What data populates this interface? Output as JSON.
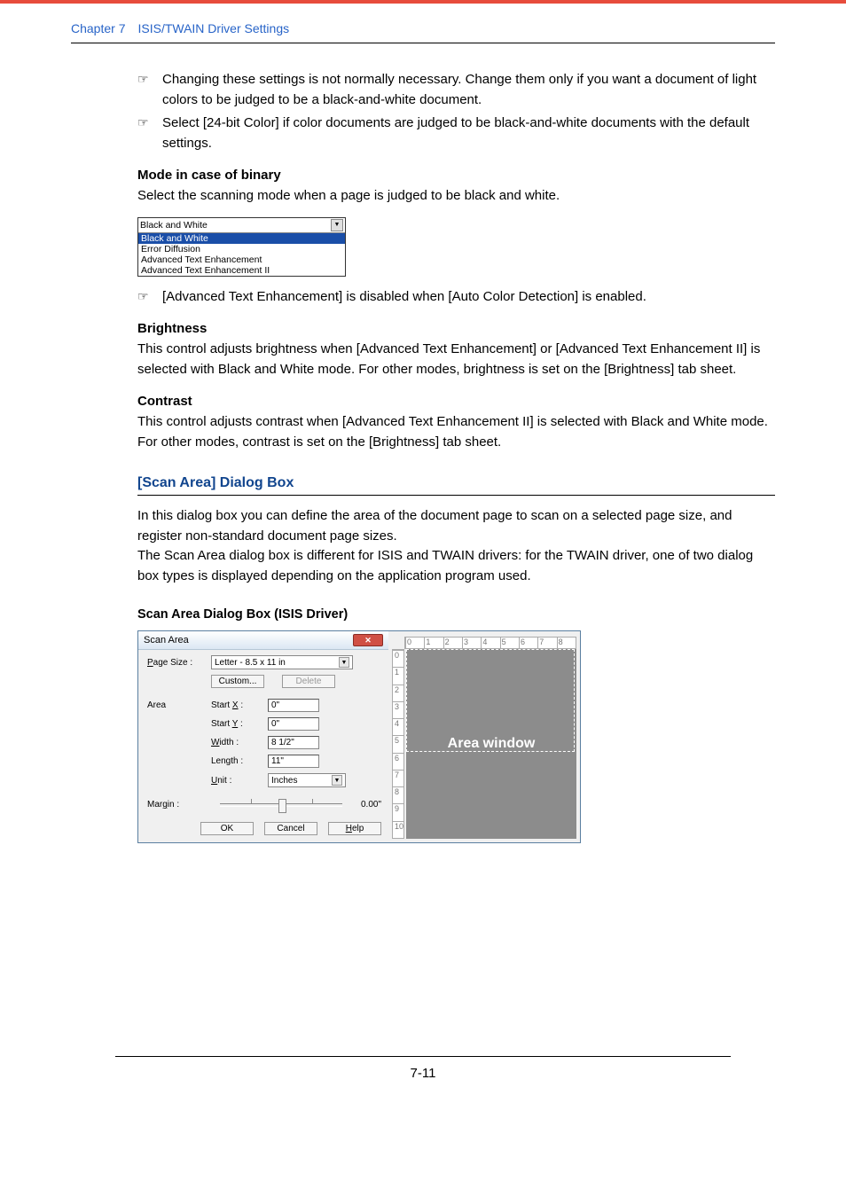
{
  "header": {
    "chapter": "Chapter 7",
    "title": "ISIS/TWAIN Driver Settings"
  },
  "bullets": {
    "b1": "Changing these settings is not normally necessary. Change them only if you want a document of light colors to be judged to be a black-and-white document.",
    "b2": "Select [24-bit Color] if color documents are judged to be black-and-white documents with the default settings.",
    "b3": "[Advanced Text Enhancement] is disabled when [Auto Color Detection] is enabled."
  },
  "mode_binary": {
    "heading": "Mode in case of binary",
    "desc": "Select the scanning mode when a page is judged to be black and white.",
    "selected": "Black and White",
    "opts": [
      "Black and White",
      "Error Diffusion",
      "Advanced Text Enhancement",
      "Advanced Text Enhancement II"
    ]
  },
  "brightness": {
    "heading": "Brightness",
    "desc": "This control adjusts brightness when [Advanced Text Enhancement] or [Advanced Text Enhancement II] is selected with Black and White mode. For other modes, brightness is set on the [Brightness] tab sheet."
  },
  "contrast": {
    "heading": "Contrast",
    "desc": "This control adjusts contrast when [Advanced Text Enhancement II] is selected with Black and White mode. For other modes, contrast is set on the [Brightness] tab sheet."
  },
  "scan_area_box": {
    "title": "[Scan Area] Dialog Box",
    "p1": "In this dialog box you can define the area of the document page to scan on a selected page size, and register non-standard document page sizes.",
    "p2": "The Scan Area dialog box is different for ISIS and TWAIN drivers: for the TWAIN driver, one of two dialog box types is displayed depending on the application program used.",
    "sub": "Scan Area Dialog Box (ISIS Driver)"
  },
  "dialog": {
    "title": "Scan Area",
    "labels": {
      "page_size": "Page Size :",
      "area": "Area",
      "startx": "Start X :",
      "starty": "Start Y :",
      "width": "Width :",
      "length": "Length :",
      "unit": "Unit :",
      "margin": "Margin :"
    },
    "values": {
      "page_size": "Letter - 8.5 x 11 in",
      "startx": "0\"",
      "starty": "0\"",
      "width": "8 1/2\"",
      "length": "11\"",
      "unit": "Inches",
      "margin": "0.00\""
    },
    "buttons": {
      "custom": "Custom...",
      "delete": "Delete",
      "ok": "OK",
      "cancel": "Cancel",
      "help": "Help"
    },
    "preview_label": "Area window",
    "ruler": [
      "0",
      "1",
      "2",
      "3",
      "4",
      "5",
      "6",
      "7",
      "8"
    ],
    "vruler": [
      "0",
      "1",
      "2",
      "3",
      "4",
      "5",
      "6",
      "7",
      "8",
      "9",
      "10"
    ]
  },
  "pagenum": "7-11"
}
